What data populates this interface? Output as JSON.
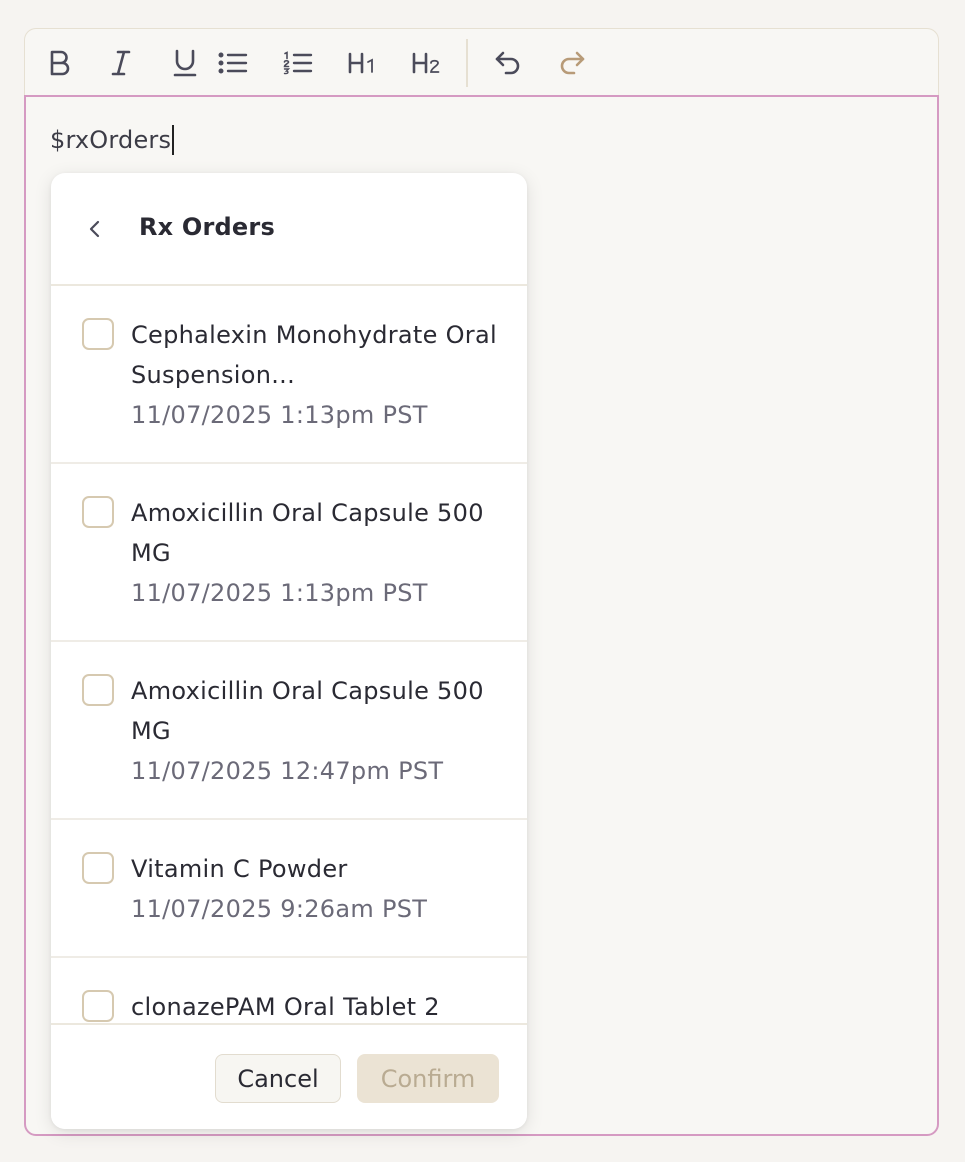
{
  "toolbar": {
    "buttons": [
      {
        "name": "bold",
        "icon": "bold-icon"
      },
      {
        "name": "italic",
        "icon": "italic-icon"
      },
      {
        "name": "underline",
        "icon": "underline-icon"
      },
      {
        "name": "bullet-list",
        "icon": "bullet-list-icon"
      },
      {
        "name": "numbered-list",
        "icon": "numbered-list-icon"
      },
      {
        "name": "heading-1",
        "icon": "heading-1-icon"
      },
      {
        "name": "heading-2",
        "icon": "heading-2-icon"
      },
      {
        "name": "undo",
        "icon": "undo-icon"
      },
      {
        "name": "redo",
        "icon": "redo-icon"
      }
    ]
  },
  "editor": {
    "typed_text": "$rxOrders"
  },
  "popup": {
    "title": "Rx Orders",
    "back_icon": "chevron-left-icon",
    "items": [
      {
        "name": "Cephalexin Monohydrate Oral Suspension...",
        "date": "11/07/2025 1:13pm PST",
        "checked": false
      },
      {
        "name": "Amoxicillin Oral Capsule 500 MG",
        "date": "11/07/2025 1:13pm PST",
        "checked": false
      },
      {
        "name": "Amoxicillin Oral Capsule 500 MG",
        "date": "11/07/2025 12:47pm PST",
        "checked": false
      },
      {
        "name": "Vitamin C Powder",
        "date": "11/07/2025 9:26am PST",
        "checked": false
      },
      {
        "name": "clonazePAM Oral Tablet 2",
        "date": "",
        "checked": false
      }
    ],
    "cancel_label": "Cancel",
    "confirm_label": "Confirm"
  },
  "colors": {
    "accent_border": "#d59ac2",
    "checkbox_border": "#d6c9b0",
    "confirm_disabled_bg": "#ebe3d4",
    "redo_icon": "#b89b78"
  }
}
